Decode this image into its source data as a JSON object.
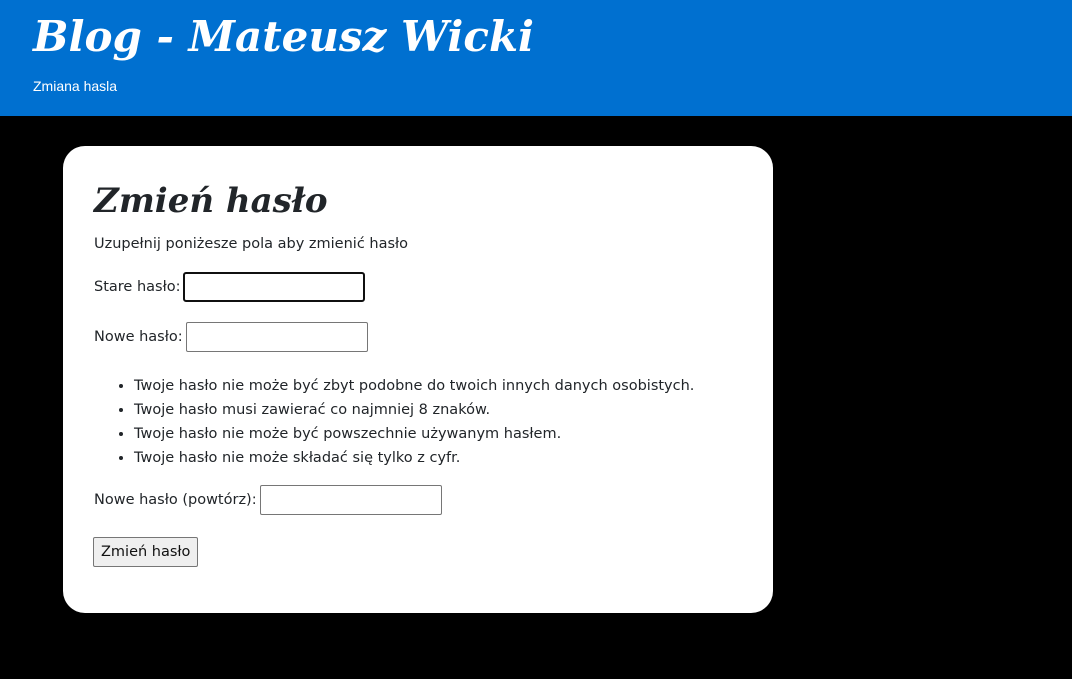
{
  "header": {
    "site_title": "Blog - Mateusz Wicki",
    "subtitle": "Zmiana hasla"
  },
  "form": {
    "title": "Zmień hasło",
    "intro": "Uzupełnij poniżesze pola aby zmienić hasło",
    "old_password_label": "Stare hasło:",
    "old_password_value": "",
    "new_password_label": "Nowe hasło:",
    "new_password_value": "",
    "password_rules": [
      "Twoje hasło nie może być zbyt podobne do twoich innych danych osobistych.",
      "Twoje hasło musi zawierać co najmniej 8 znaków.",
      "Twoje hasło nie może być powszechnie używanym hasłem.",
      "Twoje hasło nie może składać się tylko z cyfr."
    ],
    "repeat_password_label": "Nowe hasło (powtórz):",
    "repeat_password_value": "",
    "submit_label": "Zmień hasło"
  },
  "colors": {
    "header_bg": "#0070D0",
    "page_bg": "#000000",
    "card_bg": "#FFFFFF",
    "text": "#212529"
  }
}
